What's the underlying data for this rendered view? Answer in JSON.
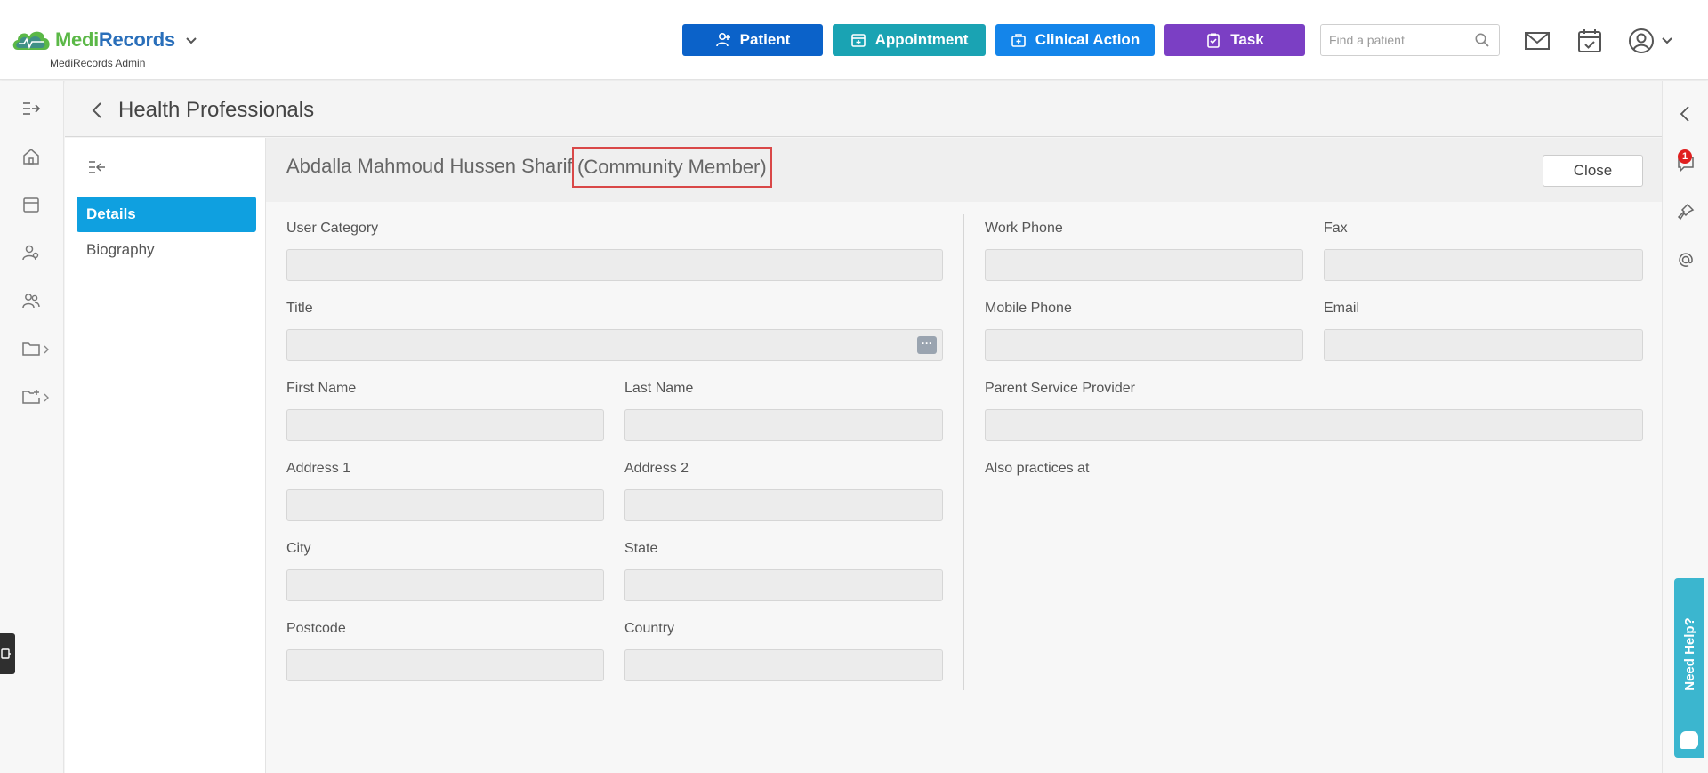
{
  "header": {
    "logo": {
      "brand_part1": "Medi",
      "brand_part2": "Records",
      "subtitle": "MediRecords Admin"
    },
    "actions": [
      {
        "label": "Patient",
        "icon": "person-add-icon",
        "color": "#0b62c9"
      },
      {
        "label": "Appointment",
        "icon": "calendar-plus-icon",
        "color": "#1aa3b3"
      },
      {
        "label": "Clinical Action",
        "icon": "medical-bag-icon",
        "color": "#1485ea"
      },
      {
        "label": "Task",
        "icon": "clipboard-check-icon",
        "color": "#7b3fc4"
      }
    ],
    "search": {
      "placeholder": "Find a patient",
      "value": ""
    }
  },
  "page": {
    "title": "Health Professionals"
  },
  "inner_nav": {
    "items": [
      {
        "label": "Details",
        "active": true
      },
      {
        "label": "Biography",
        "active": false
      }
    ]
  },
  "professional": {
    "name": "Abdalla Mahmoud Hussen Sharif",
    "role": "(Community Member)",
    "close_label": "Close"
  },
  "form": {
    "left": {
      "user_category": "User Category",
      "title": "Title",
      "first_name": "First Name",
      "last_name": "Last Name",
      "address1": "Address 1",
      "address2": "Address 2",
      "city": "City",
      "state": "State",
      "postcode": "Postcode",
      "country": "Country",
      "title_dots": "···"
    },
    "right": {
      "work_phone": "Work Phone",
      "fax": "Fax",
      "mobile_phone": "Mobile Phone",
      "email": "Email",
      "parent_service_provider": "Parent Service Provider",
      "also_practices_at": "Also practices at"
    }
  },
  "right_rail": {
    "notification_count": "1",
    "help_label": "Need Help?"
  },
  "colors": {
    "accent": "#0fa0e0",
    "highlight_border": "#d94848",
    "badge": "#e02020",
    "help_tab": "#3bb6cf"
  }
}
